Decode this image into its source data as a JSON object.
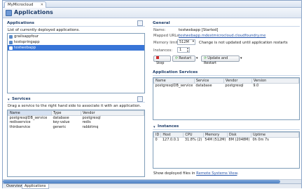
{
  "editor_tab": {
    "label": "MyMicrocloud",
    "close": "✕"
  },
  "header": {
    "title": "Applications"
  },
  "applications": {
    "section_title": "Applications",
    "description": "List of currently deployed applications.",
    "items": [
      "grailsappfour",
      "testspringapp",
      "testwebapp"
    ],
    "selected": "testwebapp"
  },
  "services": {
    "section_title": "Services",
    "description": "Drag a service to the right hand side to associate it with an application.",
    "columns": [
      "Name",
      "Type",
      "Vendor"
    ],
    "rows": [
      [
        "postgresqlDB_service",
        "database",
        "postgresql"
      ],
      [
        "redisservice",
        "key-value",
        "redis"
      ],
      [
        "thirdservice",
        "generic",
        "rabbitmq"
      ]
    ]
  },
  "general": {
    "section_title": "General",
    "name_label": "Name:",
    "name_value": "testwebapp [Started]",
    "urls_label": "Mapped URLs:",
    "urls_value": "testwebapp.mdestmicrocloud.cloudfoundry.me",
    "memory_label": "Memory limit:",
    "memory_value": "512M",
    "memory_note": "Change is not updated until application restarts",
    "instances_label": "Instances:",
    "instances_value": "1",
    "stop_label": "Stop",
    "restart_label": "Restart",
    "update_restart_label": "Update and Restart"
  },
  "app_services": {
    "section_title": "Application Services",
    "columns": [
      "Name",
      "Service",
      "Vendor",
      "Version"
    ],
    "rows": [
      [
        "postgresqlDB_service",
        "database",
        "postgresql",
        "9.0"
      ]
    ]
  },
  "instances": {
    "section_title": "Instances",
    "columns": [
      "ID",
      "Host",
      "CPU",
      "Memory",
      "Disk",
      "Uptime"
    ],
    "rows": [
      [
        "0",
        "127.0.0.1",
        "31.8% (2)",
        "54M (512M)",
        "8M (2048M)",
        "0h 0m 7s"
      ]
    ],
    "footer_text": "Show deployed files in",
    "footer_link": "Remote Systems View",
    "footer_end": "."
  },
  "bottom_tabs": [
    "Overview",
    "Applications"
  ]
}
